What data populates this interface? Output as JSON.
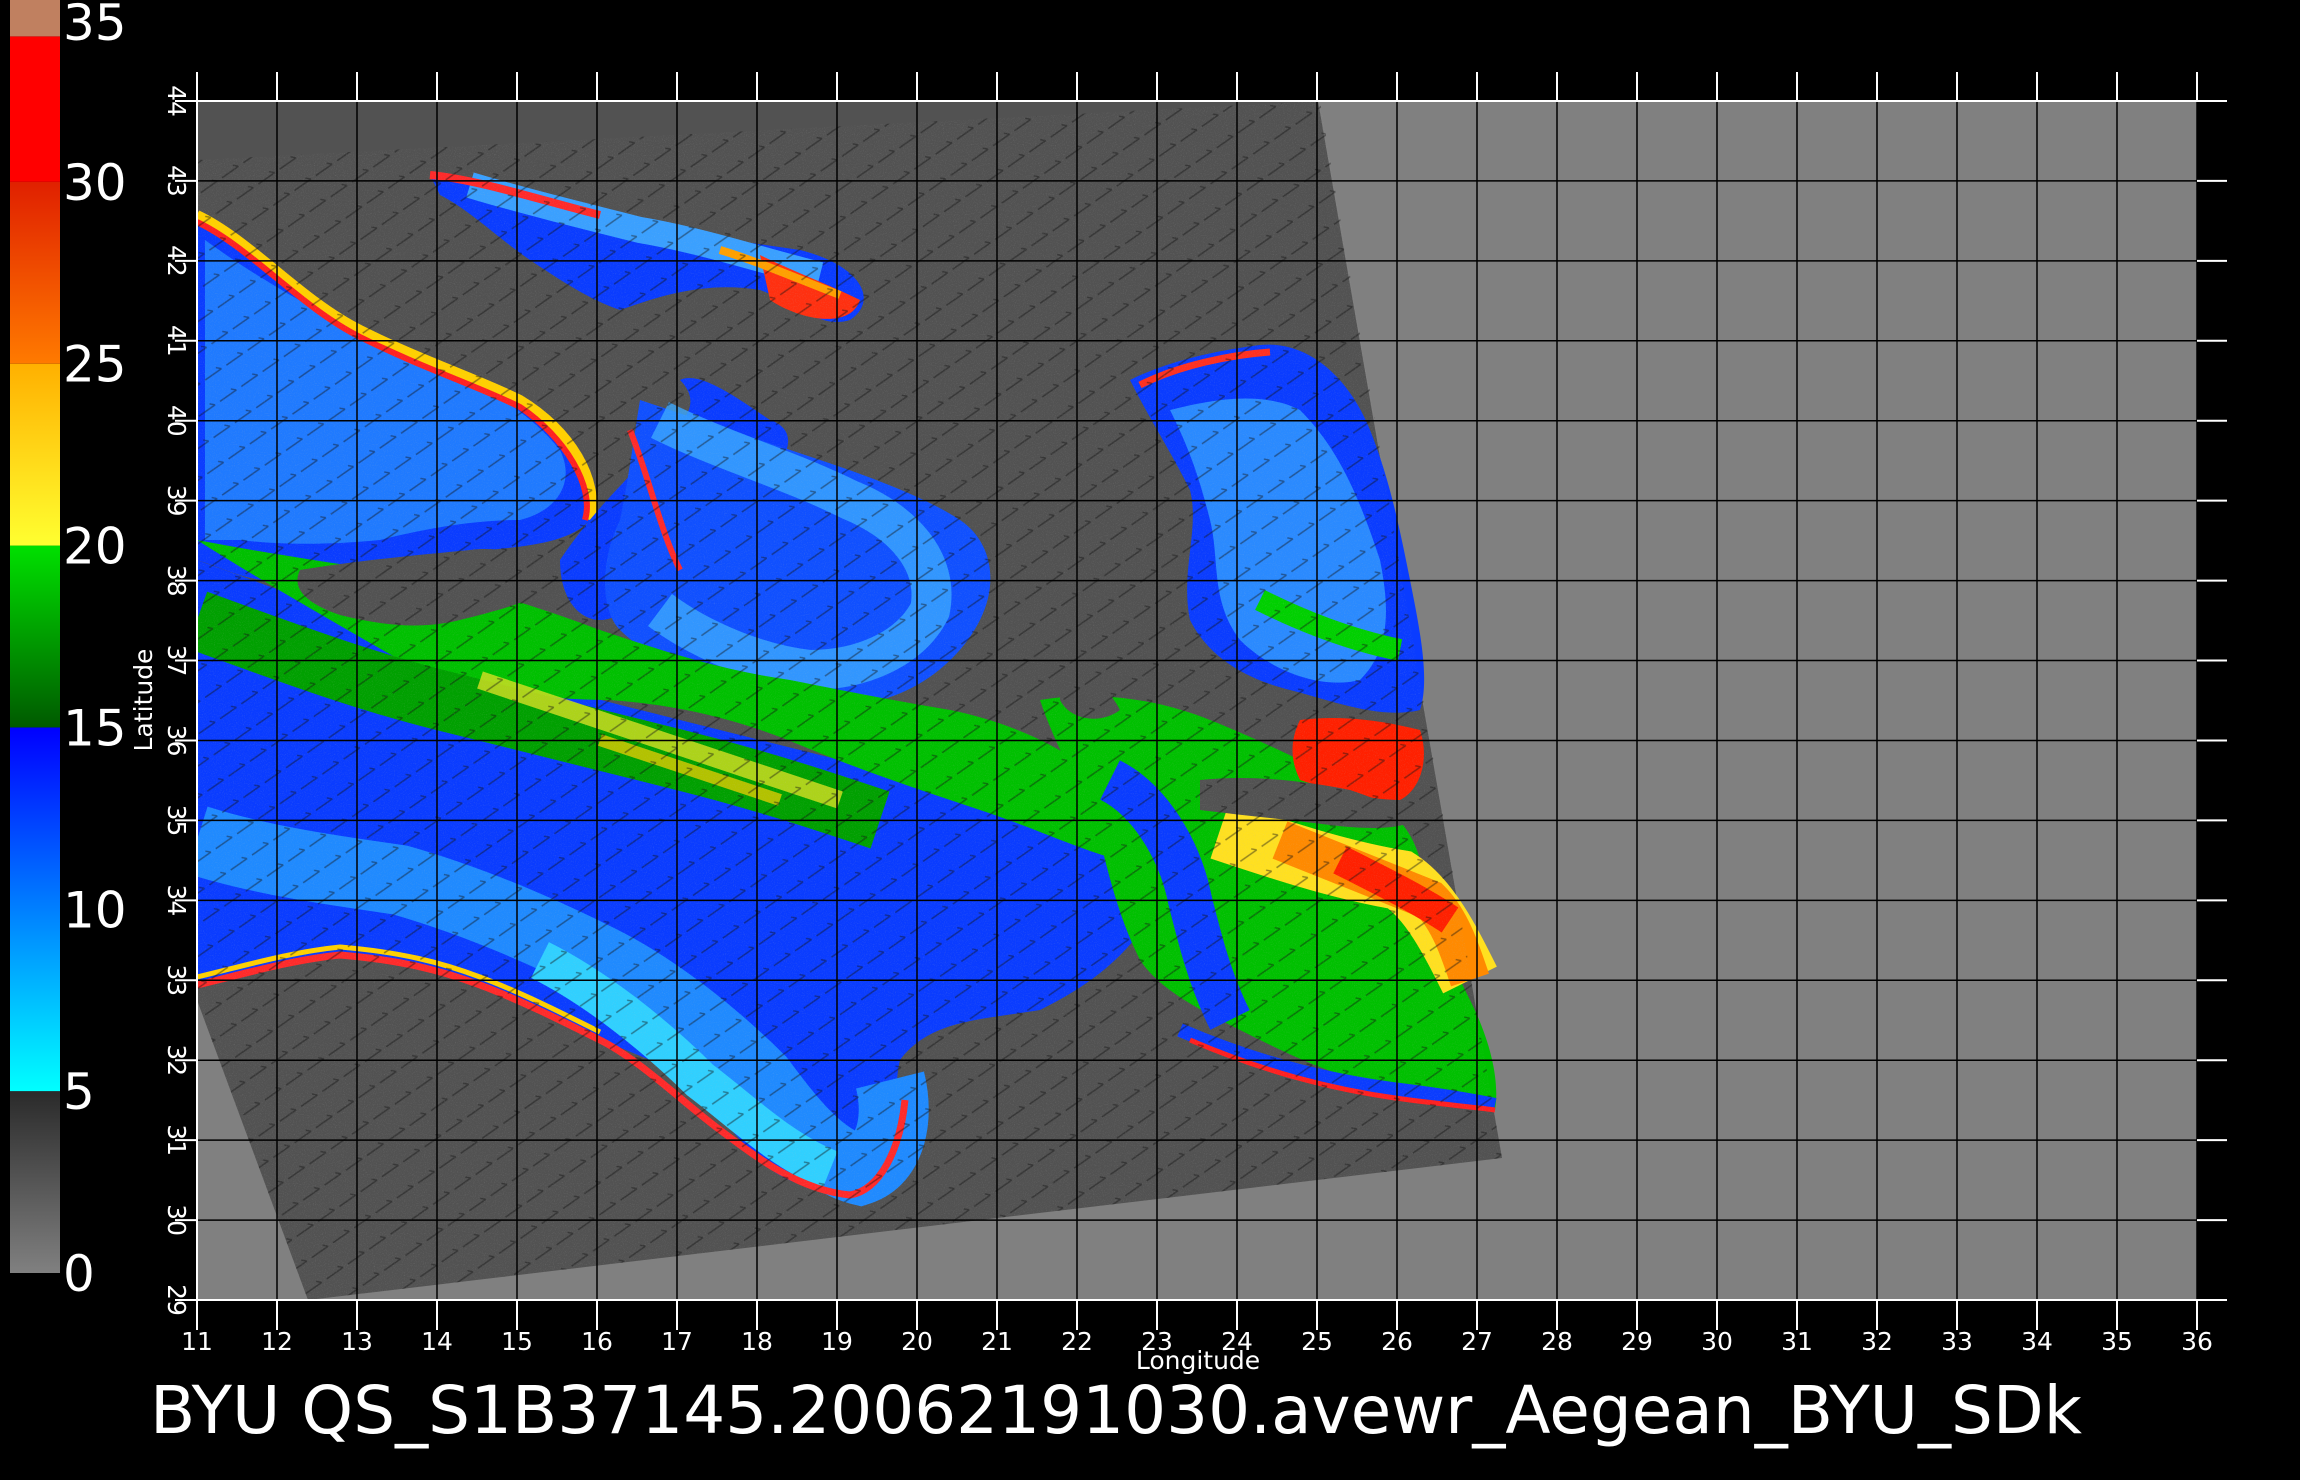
{
  "colorbar": {
    "tick_labels": [
      "35",
      "30",
      "25",
      "20",
      "15",
      "10",
      "5",
      "0"
    ],
    "range": [
      0,
      35
    ],
    "bands": [
      {
        "from": 0,
        "to": 5,
        "color": "#808080",
        "color_end": "#2a2a2a"
      },
      {
        "from": 5,
        "to": 15,
        "color": "#00ffff",
        "color_end": "#0000ff"
      },
      {
        "from": 15,
        "to": 20,
        "color": "#005a00",
        "color_end": "#00e000"
      },
      {
        "from": 20,
        "to": 25,
        "color": "#ffff30",
        "color_end": "#ffb000"
      },
      {
        "from": 25,
        "to": 30,
        "color": "#ff7a00",
        "color_end": "#e02000"
      },
      {
        "from": 30,
        "to": 34,
        "color": "#ff0000",
        "color_end": "#ff0000"
      },
      {
        "from": 34,
        "to": 35,
        "color": "#c08060",
        "color_end": "#c08060"
      }
    ]
  },
  "map": {
    "lon_ticks": [
      "11",
      "12",
      "13",
      "14",
      "15",
      "16",
      "17",
      "18",
      "19",
      "20",
      "21",
      "22",
      "23",
      "24",
      "25",
      "26",
      "27",
      "28",
      "29",
      "30",
      "31",
      "32",
      "33",
      "34",
      "35",
      "36"
    ],
    "lat_ticks": [
      "29",
      "30",
      "31",
      "32",
      "33",
      "34",
      "35",
      "36",
      "37",
      "38",
      "39",
      "40",
      "41",
      "42",
      "43",
      "44"
    ],
    "lon_range": [
      11,
      36
    ],
    "lat_range": [
      29,
      44
    ],
    "xlabel": "Longitude",
    "ylabel": "Latitude",
    "colors": {
      "nodata": "#808080",
      "swath": "#525252",
      "grid": "#000000"
    }
  },
  "footer": {
    "title": "BYU  QS_S1B37145.20062191030.avewr_Aegean_BYU_SDk"
  }
}
